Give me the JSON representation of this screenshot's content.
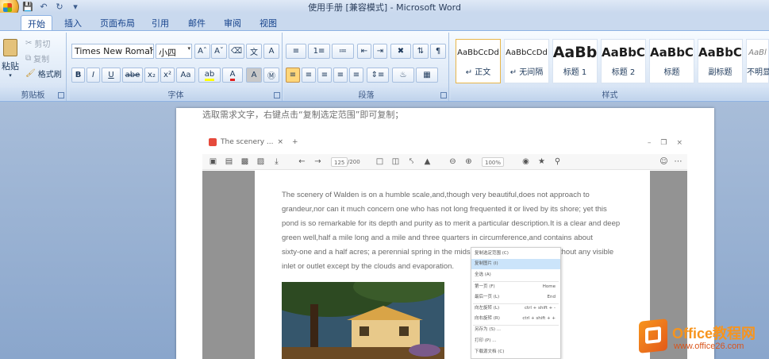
{
  "window": {
    "title": "使用手册 [兼容模式] - Microsoft Word"
  },
  "ribbon_tabs": [
    "开始",
    "插入",
    "页面布局",
    "引用",
    "邮件",
    "审阅",
    "视图"
  ],
  "clipboard": {
    "paste_label": "粘贴",
    "cut_label": "剪切",
    "copy_label": "复制",
    "format_painter_label": "格式刷",
    "group_label": "剪贴板"
  },
  "font": {
    "font_name": "Times New Romar",
    "font_size": "小四",
    "group_label": "字体"
  },
  "paragraph": {
    "group_label": "段落"
  },
  "styles": {
    "group_label": "样式",
    "items": [
      {
        "preview": "AaBbCcDd",
        "name": "↵ 正文"
      },
      {
        "preview": "AaBbCcDd",
        "name": "↵ 无间隔"
      },
      {
        "preview": "AaBb",
        "name": "标题 1"
      },
      {
        "preview": "AaBbC",
        "name": "标题 2"
      },
      {
        "preview": "AaBbC",
        "name": "标题"
      },
      {
        "preview": "AaBbC",
        "name": "副标题"
      },
      {
        "preview": "AaBl",
        "name": "不明显"
      }
    ]
  },
  "document": {
    "caption": "选取需求文字，右键点击“复制选定范围”即可复制；"
  },
  "reader": {
    "tab_title": "The scenery ...",
    "page_current": "125",
    "page_total": "/200",
    "zoom": "100%",
    "paragraph_lines": [
      "The scenery of Walden is on a humble scale,and,though very beautiful,does not approach to",
      "grandeur,nor can it much concern one who has not long frequented it or lived by its shore; yet this",
      "pond is so remarkable for its depth and purity as to merit a particular description.It is a clear and deep",
      "green well,half a mile long and a mile and three quarters in circumference,and contains about",
      "sixty-one and a half acres; a perennial spring in the mids",
      "inlet or outlet except by the clouds and evaporation."
    ],
    "line5_tail": "thout any visible"
  },
  "context_menu": {
    "items": [
      {
        "label": "复制选定范围  (C)",
        "shortcut": ""
      },
      {
        "label": "复制图片  (I)",
        "shortcut": ""
      },
      {
        "label": "全选  (A)",
        "shortcut": ""
      },
      {
        "label": "第一页  (F)",
        "shortcut": "Home"
      },
      {
        "label": "最后一页  (L)",
        "shortcut": "End"
      },
      {
        "label": "向左旋转  (L)",
        "shortcut": "ctrl + shift + -"
      },
      {
        "label": "向右旋转  (R)",
        "shortcut": "ctrl + shift + +"
      },
      {
        "label": "另存为  (S) ...",
        "shortcut": ""
      },
      {
        "label": "打印  (P) ...",
        "shortcut": ""
      },
      {
        "label": "下载源文档  (C)",
        "shortcut": ""
      }
    ]
  },
  "watermark": {
    "brand": "Office教程网",
    "url": "www.office26.com"
  }
}
